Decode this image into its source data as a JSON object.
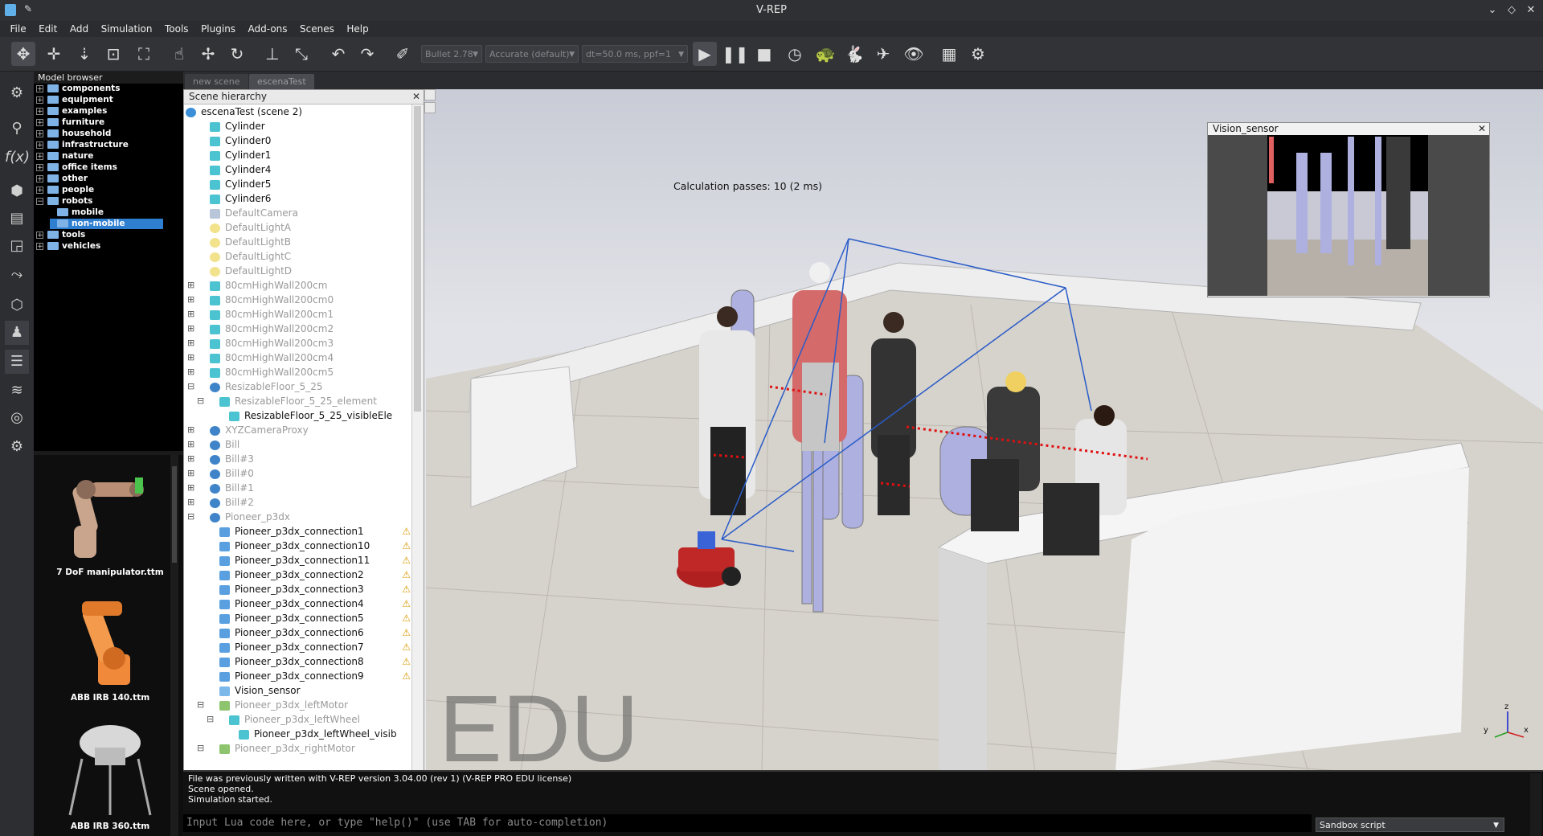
{
  "app": {
    "title": "V-REP"
  },
  "menu": [
    "File",
    "Edit",
    "Add",
    "Simulation",
    "Tools",
    "Plugins",
    "Add-ons",
    "Scenes",
    "Help"
  ],
  "toolbar": {
    "engine": "Bullet 2.78",
    "accuracy": "Accurate (default)",
    "timestep": "dt=50.0 ms, ppf=1"
  },
  "model_browser": {
    "title": "Model browser",
    "items": [
      {
        "label": "components",
        "expanded": false
      },
      {
        "label": "equipment",
        "expanded": false
      },
      {
        "label": "examples",
        "expanded": false
      },
      {
        "label": "furniture",
        "expanded": false
      },
      {
        "label": "household",
        "expanded": false
      },
      {
        "label": "infrastructure",
        "expanded": false
      },
      {
        "label": "nature",
        "expanded": false
      },
      {
        "label": "office items",
        "expanded": false
      },
      {
        "label": "other",
        "expanded": false
      },
      {
        "label": "people",
        "expanded": false
      },
      {
        "label": "robots",
        "expanded": true
      },
      {
        "label": "mobile",
        "child": true
      },
      {
        "label": "non-mobile",
        "child": true,
        "selected": true
      },
      {
        "label": "tools",
        "expanded": false
      },
      {
        "label": "vehicles",
        "expanded": false
      }
    ],
    "thumbnails": [
      "7 DoF manipulator.ttm",
      "ABB IRB 140.ttm",
      "ABB IRB 360.ttm"
    ]
  },
  "scene_tabs": [
    "new scene",
    "escenaTest"
  ],
  "hierarchy": {
    "title": "Scene hierarchy",
    "root": "escenaTest (scene 2)",
    "rows": [
      {
        "label": "Cylinder",
        "icon": "shape",
        "indent": 1
      },
      {
        "label": "Cylinder0",
        "icon": "shape",
        "indent": 1
      },
      {
        "label": "Cylinder1",
        "icon": "shape",
        "indent": 1
      },
      {
        "label": "Cylinder4",
        "icon": "shape",
        "indent": 1
      },
      {
        "label": "Cylinder5",
        "icon": "shape",
        "indent": 1
      },
      {
        "label": "Cylinder6",
        "icon": "shape",
        "indent": 1
      },
      {
        "label": "DefaultCamera",
        "icon": "cam",
        "indent": 1,
        "dim": true
      },
      {
        "label": "DefaultLightA",
        "icon": "light",
        "indent": 1,
        "dim": true
      },
      {
        "label": "DefaultLightB",
        "icon": "light",
        "indent": 1,
        "dim": true
      },
      {
        "label": "DefaultLightC",
        "icon": "light",
        "indent": 1,
        "dim": true
      },
      {
        "label": "DefaultLightD",
        "icon": "light",
        "indent": 1,
        "dim": true
      },
      {
        "label": "80cmHighWall200cm",
        "icon": "shape",
        "indent": 1,
        "dim": true,
        "exp": "+"
      },
      {
        "label": "80cmHighWall200cm0",
        "icon": "shape",
        "indent": 1,
        "dim": true,
        "exp": "+"
      },
      {
        "label": "80cmHighWall200cm1",
        "icon": "shape",
        "indent": 1,
        "dim": true,
        "exp": "+"
      },
      {
        "label": "80cmHighWall200cm2",
        "icon": "shape",
        "indent": 1,
        "dim": true,
        "exp": "+"
      },
      {
        "label": "80cmHighWall200cm3",
        "icon": "shape",
        "indent": 1,
        "dim": true,
        "exp": "+"
      },
      {
        "label": "80cmHighWall200cm4",
        "icon": "shape",
        "indent": 1,
        "dim": true,
        "exp": "+"
      },
      {
        "label": "80cmHighWall200cm5",
        "icon": "shape",
        "indent": 1,
        "dim": true,
        "exp": "+"
      },
      {
        "label": "ResizableFloor_5_25",
        "icon": "model",
        "indent": 1,
        "dim": true,
        "exp": "-"
      },
      {
        "label": "ResizableFloor_5_25_element",
        "icon": "shape",
        "indent": 2,
        "dim": true,
        "exp": "-"
      },
      {
        "label": "ResizableFloor_5_25_visibleEle",
        "icon": "shape",
        "indent": 3
      },
      {
        "label": "XYZCameraProxy",
        "icon": "model",
        "indent": 1,
        "dim": true,
        "exp": "+"
      },
      {
        "label": "Bill",
        "icon": "model",
        "indent": 1,
        "dim": true,
        "exp": "+"
      },
      {
        "label": "Bill#3",
        "icon": "model",
        "indent": 1,
        "dim": true,
        "exp": "+"
      },
      {
        "label": "Bill#0",
        "icon": "model",
        "indent": 1,
        "dim": true,
        "exp": "+"
      },
      {
        "label": "Bill#1",
        "icon": "model",
        "indent": 1,
        "dim": true,
        "exp": "+"
      },
      {
        "label": "Bill#2",
        "icon": "model",
        "indent": 1,
        "dim": true,
        "exp": "+"
      },
      {
        "label": "Pioneer_p3dx",
        "icon": "model",
        "indent": 1,
        "dim": true,
        "exp": "-"
      },
      {
        "label": "Pioneer_p3dx_connection1",
        "icon": "joint",
        "indent": 2,
        "warn": true
      },
      {
        "label": "Pioneer_p3dx_connection10",
        "icon": "joint",
        "indent": 2,
        "warn": true
      },
      {
        "label": "Pioneer_p3dx_connection11",
        "icon": "joint",
        "indent": 2,
        "warn": true
      },
      {
        "label": "Pioneer_p3dx_connection2",
        "icon": "joint",
        "indent": 2,
        "warn": true
      },
      {
        "label": "Pioneer_p3dx_connection3",
        "icon": "joint",
        "indent": 2,
        "warn": true
      },
      {
        "label": "Pioneer_p3dx_connection4",
        "icon": "joint",
        "indent": 2,
        "warn": true
      },
      {
        "label": "Pioneer_p3dx_connection5",
        "icon": "joint",
        "indent": 2,
        "warn": true
      },
      {
        "label": "Pioneer_p3dx_connection6",
        "icon": "joint",
        "indent": 2,
        "warn": true
      },
      {
        "label": "Pioneer_p3dx_connection7",
        "icon": "joint",
        "indent": 2,
        "warn": true
      },
      {
        "label": "Pioneer_p3dx_connection8",
        "icon": "joint",
        "indent": 2,
        "warn": true
      },
      {
        "label": "Pioneer_p3dx_connection9",
        "icon": "joint",
        "indent": 2,
        "warn": true
      },
      {
        "label": "Vision_sensor",
        "icon": "sensor",
        "indent": 2
      },
      {
        "label": "Pioneer_p3dx_leftMotor",
        "icon": "motor",
        "indent": 2,
        "dim": true,
        "exp": "-"
      },
      {
        "label": "Pioneer_p3dx_leftWheel",
        "icon": "shape",
        "indent": 3,
        "dim": true,
        "exp": "-"
      },
      {
        "label": "Pioneer_p3dx_leftWheel_visib",
        "icon": "shape",
        "indent": 4
      },
      {
        "label": "Pioneer_p3dx_rightMotor",
        "icon": "motor",
        "indent": 2,
        "dim": true,
        "exp": "-"
      }
    ]
  },
  "viewport": {
    "calc_text": "Calculation passes: 10 (2 ms)",
    "watermark": "EDU",
    "vision_sensor_title": "Vision_sensor",
    "axis_x": "x",
    "axis_y": "y",
    "axis_z": "z"
  },
  "console": {
    "lines": [
      "File was previously written with V-REP version 3.04.00 (rev 1) (V-REP PRO EDU license)",
      "Scene opened.",
      "Simulation started."
    ],
    "input_placeholder": "Input Lua code here, or type \"help()\" (use TAB for auto-completion)",
    "script_select": "Sandbox script"
  }
}
